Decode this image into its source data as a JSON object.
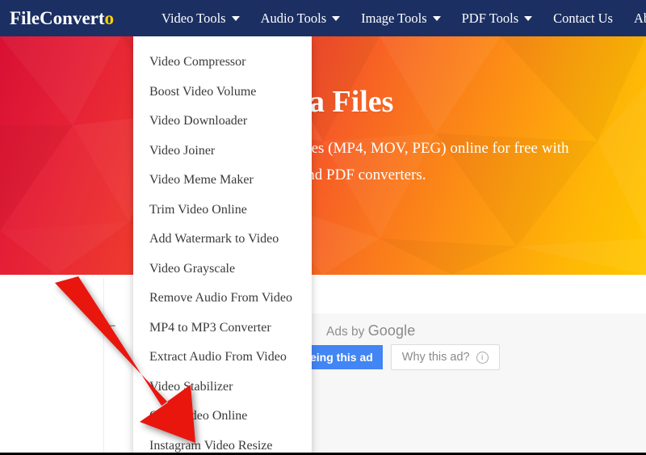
{
  "site": {
    "logo_main": "FileConvert",
    "logo_accent": "o"
  },
  "navbar": {
    "items": [
      {
        "label": "Video Tools",
        "has_caret": true
      },
      {
        "label": "Audio Tools",
        "has_caret": true
      },
      {
        "label": "Image Tools",
        "has_caret": true
      },
      {
        "label": "PDF Tools",
        "has_caret": true
      },
      {
        "label": "Contact Us",
        "has_caret": false
      },
      {
        "label": "About",
        "has_caret": false
      }
    ],
    "background_color": "#1b2f63"
  },
  "dropdown": {
    "owner": "Video Tools",
    "items": [
      "Video Compressor",
      "Boost Video Volume",
      "Video Downloader",
      "Video Joiner",
      "Video Meme Maker",
      "Trim Video Online",
      "Add Watermark to Video",
      "Video Grayscale",
      "Remove Audio From Video",
      "MP4 to MP3 Converter",
      "Extract Audio From Video",
      "Video Stabilizer",
      "Crop Video Online",
      "Instagram Video Resize"
    ]
  },
  "hero": {
    "title": "Multimedia Files",
    "subtitle": "and edit multimedia files (MP4, MOV, PEG) online for free with our easy-to-use udio and PDF converters.",
    "gradient_start": "#d81034",
    "gradient_end": "#ffc800"
  },
  "carousel": {
    "prev_icon": "←"
  },
  "ad": {
    "label_prefix": "Ads by",
    "label_brand": "Google",
    "stop_button": "eing this ad",
    "why_button": "Why this ad?",
    "why_icon": "i",
    "accent_color": "#4285f4"
  },
  "annotation": {
    "arrow_color": "#e8120c",
    "points_to": "Instagram Video Resize"
  }
}
